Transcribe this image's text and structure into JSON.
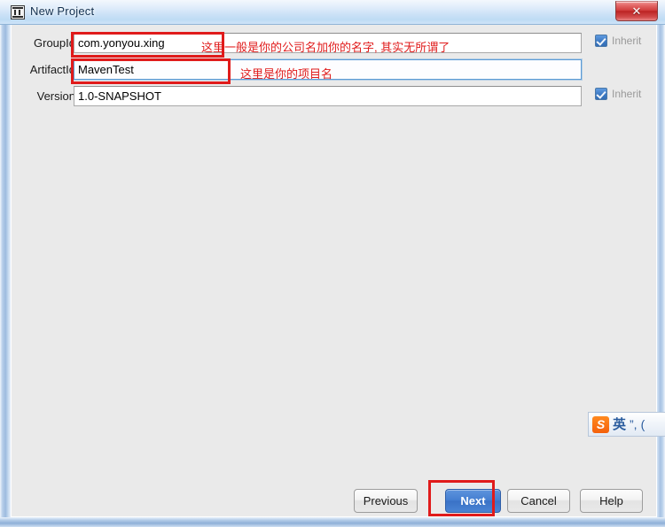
{
  "window": {
    "title": "New Project",
    "icon": "intellij-idea-icon",
    "close_label": "✕"
  },
  "form": {
    "rows": [
      {
        "label": "GroupId",
        "value": "com.yonyou.xing",
        "placeholder": "",
        "focused": false,
        "has_inherit": true,
        "inherit_label": "Inherit",
        "inherit_checked": true
      },
      {
        "label": "ArtifactId",
        "value": "MavenTest",
        "placeholder": "",
        "focused": true,
        "has_inherit": false,
        "inherit_label": "",
        "inherit_checked": false
      },
      {
        "label": "Version",
        "value": "1.0-SNAPSHOT",
        "placeholder": "",
        "focused": false,
        "has_inherit": true,
        "inherit_label": "Inherit",
        "inherit_checked": true
      }
    ]
  },
  "annotations": {
    "color": "#e01b1b",
    "groupid_note": "这里一般是你的公司名加你的名字, 其实无所谓了",
    "artifactid_note": "这里是你的项目名",
    "boxes": [
      "groupid-field",
      "artifactid-field",
      "next-button"
    ]
  },
  "buttons": {
    "previous": "Previous",
    "next": "Next",
    "cancel": "Cancel",
    "help": "Help",
    "default_button": "Next",
    "primary_color": "#4680d2"
  },
  "ime": {
    "logo": "sogou-logo-icon",
    "logo_text": "S",
    "mode": "英",
    "punctuation": "”,",
    "extra": "("
  }
}
